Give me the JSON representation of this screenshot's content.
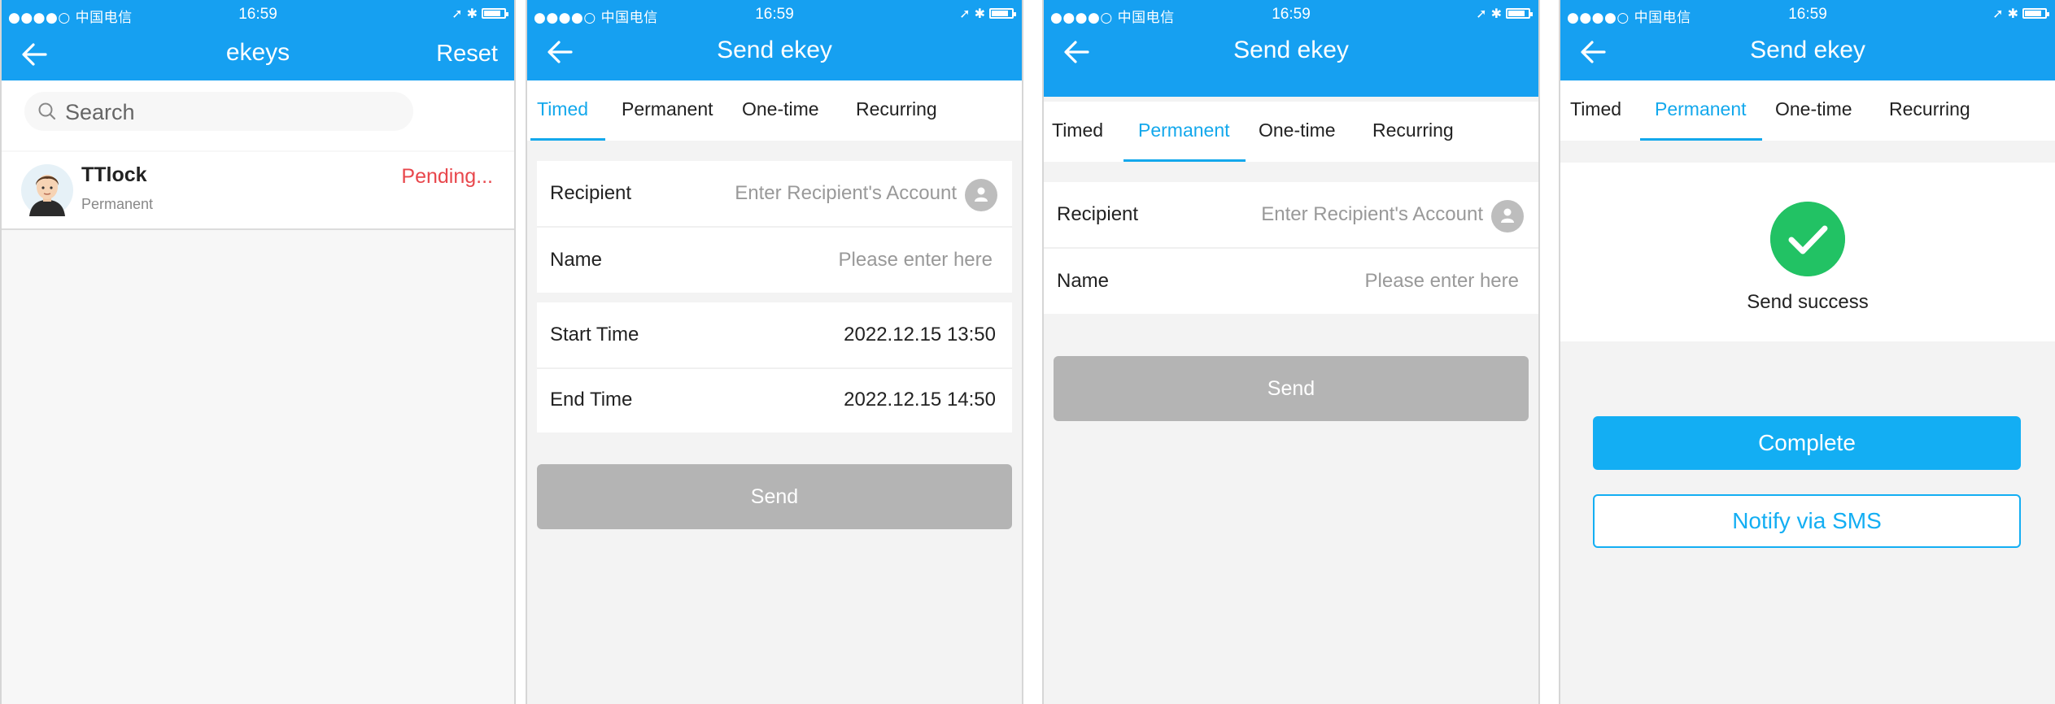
{
  "status_bar": {
    "carrier": "●●●●○ 中国电信",
    "time": "16:59"
  },
  "colors": {
    "primary": "#16a0f1",
    "accent_tab": "#13a8ec",
    "pending": "#e8474c",
    "disabled_button": "#b4b4b4",
    "success": "#22c264"
  },
  "screen1": {
    "title": "ekeys",
    "action": "Reset",
    "search_placeholder": "Search",
    "key": {
      "name": "TTlock",
      "type": "Permanent",
      "status": "Pending..."
    }
  },
  "screen2": {
    "title": "Send ekey",
    "tabs": [
      "Timed",
      "Permanent",
      "One-time",
      "Recurring"
    ],
    "active_tab": "Timed",
    "recipient_label": "Recipient",
    "recipient_placeholder": "Enter Recipient's Account",
    "name_label": "Name",
    "name_placeholder": "Please enter here",
    "start_label": "Start Time",
    "start_value": "2022.12.15 13:50",
    "end_label": "End Time",
    "end_value": "2022.12.15 14:50",
    "send_label": "Send"
  },
  "screen3": {
    "title": "Send ekey",
    "tabs": [
      "Timed",
      "Permanent",
      "One-time",
      "Recurring"
    ],
    "active_tab": "Permanent",
    "recipient_label": "Recipient",
    "recipient_placeholder": "Enter Recipient's Account",
    "name_label": "Name",
    "name_placeholder": "Please enter here",
    "send_label": "Send"
  },
  "screen4": {
    "title": "Send ekey",
    "tabs": [
      "Timed",
      "Permanent",
      "One-time",
      "Recurring"
    ],
    "active_tab": "Permanent",
    "success_text": "Send success",
    "complete_label": "Complete",
    "sms_label": "Notify via SMS"
  }
}
